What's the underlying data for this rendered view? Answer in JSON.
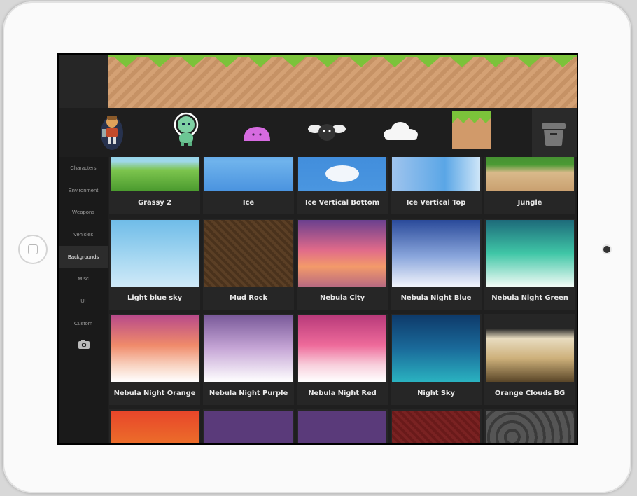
{
  "sidebar": {
    "items": [
      {
        "label": "Characters",
        "active": false
      },
      {
        "label": "Environment",
        "active": false
      },
      {
        "label": "Weapons",
        "active": false
      },
      {
        "label": "Vehicles",
        "active": false
      },
      {
        "label": "Backgrounds",
        "active": true
      },
      {
        "label": "Misc",
        "active": false
      },
      {
        "label": "UI",
        "active": false
      },
      {
        "label": "Custom",
        "active": false
      }
    ],
    "camera_icon": "camera-icon"
  },
  "toolbar": {
    "items": [
      "character-knight-icon",
      "character-alien-icon",
      "character-slime-icon",
      "character-winged-blob-icon",
      "cloud-icon",
      "grass-block-icon"
    ],
    "trash_icon": "trash-icon"
  },
  "grid": {
    "rows": [
      [
        "Grassy 2",
        "Ice",
        "Ice Vertical Bottom",
        "Ice Vertical Top",
        "Jungle"
      ],
      [
        "Light blue sky",
        "Mud Rock",
        "Nebula City",
        "Nebula Night Blue",
        "Nebula Night Green"
      ],
      [
        "Nebula Night Orange",
        "Nebula Night Purple",
        "Nebula Night Red",
        "Night Sky",
        "Orange Clouds BG"
      ],
      [
        "",
        "",
        "",
        "",
        ""
      ]
    ]
  },
  "colors": {
    "accent_green": "#7bc33a",
    "dirt": "#d19a6a",
    "ui_dark": "#1e1e1e"
  }
}
